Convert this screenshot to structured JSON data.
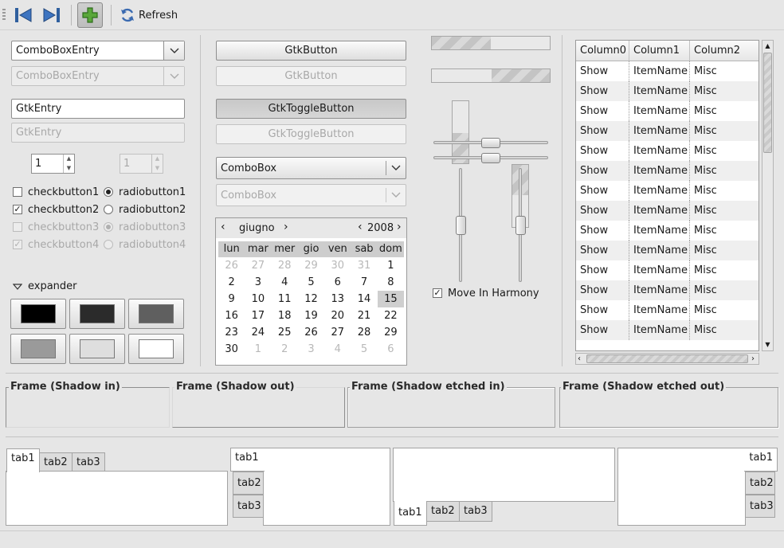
{
  "toolbar": {
    "refresh_label": "Refresh"
  },
  "left": {
    "combo_entry": "ComboBoxEntry",
    "combo_entry_disabled": "ComboBoxEntry",
    "entry": "GtkEntry",
    "entry_disabled": "GtkEntry",
    "spin_value": "1",
    "spin_value_disabled": "1",
    "checkbuttons": [
      "checkbutton1",
      "checkbutton2",
      "checkbutton3",
      "checkbutton4"
    ],
    "radiobuttons": [
      "radiobutton1",
      "radiobutton2",
      "radiobutton3",
      "radiobutton4"
    ],
    "expander_label": "expander",
    "color_swatches": [
      "#000000",
      "#2b2b2b",
      "#5f5f5f",
      "#9a9a9a",
      "#dedede",
      "#ffffff"
    ]
  },
  "middle": {
    "button": "GtkButton",
    "button_disabled": "GtkButton",
    "toggle": "GtkToggleButton",
    "toggle_disabled": "GtkToggleButton",
    "combo": "ComboBox",
    "combo_disabled": "ComboBox"
  },
  "calendar": {
    "month": "giugno",
    "year": "2008",
    "weekdays": [
      "lun",
      "mar",
      "mer",
      "gio",
      "ven",
      "sab",
      "dom"
    ],
    "days": [
      [
        "26",
        "27",
        "28",
        "29",
        "30",
        "31",
        "1"
      ],
      [
        "2",
        "3",
        "4",
        "5",
        "6",
        "7",
        "8"
      ],
      [
        "9",
        "10",
        "11",
        "12",
        "13",
        "14",
        "15"
      ],
      [
        "16",
        "17",
        "18",
        "19",
        "20",
        "21",
        "22"
      ],
      [
        "23",
        "24",
        "25",
        "26",
        "27",
        "28",
        "29"
      ],
      [
        "30",
        "1",
        "2",
        "3",
        "4",
        "5",
        "6"
      ]
    ],
    "selected_day": "15"
  },
  "ranges": {
    "harmony_label": "Move In Harmony"
  },
  "treeview": {
    "columns": [
      "Column0",
      "Column1",
      "Column2"
    ],
    "rows": [
      [
        "Show",
        "ItemName",
        "Misc"
      ],
      [
        "Show",
        "ItemName",
        "Misc"
      ],
      [
        "Show",
        "ItemName",
        "Misc"
      ],
      [
        "Show",
        "ItemName",
        "Misc"
      ],
      [
        "Show",
        "ItemName",
        "Misc"
      ],
      [
        "Show",
        "ItemName",
        "Misc"
      ],
      [
        "Show",
        "ItemName",
        "Misc"
      ],
      [
        "Show",
        "ItemName",
        "Misc"
      ],
      [
        "Show",
        "ItemName",
        "Misc"
      ],
      [
        "Show",
        "ItemName",
        "Misc"
      ],
      [
        "Show",
        "ItemName",
        "Misc"
      ],
      [
        "Show",
        "ItemName",
        "Misc"
      ],
      [
        "Show",
        "ItemName",
        "Misc"
      ],
      [
        "Show",
        "ItemName",
        "Misc"
      ]
    ]
  },
  "frames": [
    "Frame (Shadow in)",
    "Frame (Shadow out)",
    "Frame (Shadow etched in)",
    "Frame (Shadow etched out)"
  ],
  "notebooks": {
    "tabs": [
      "tab1",
      "tab2",
      "tab3"
    ]
  }
}
